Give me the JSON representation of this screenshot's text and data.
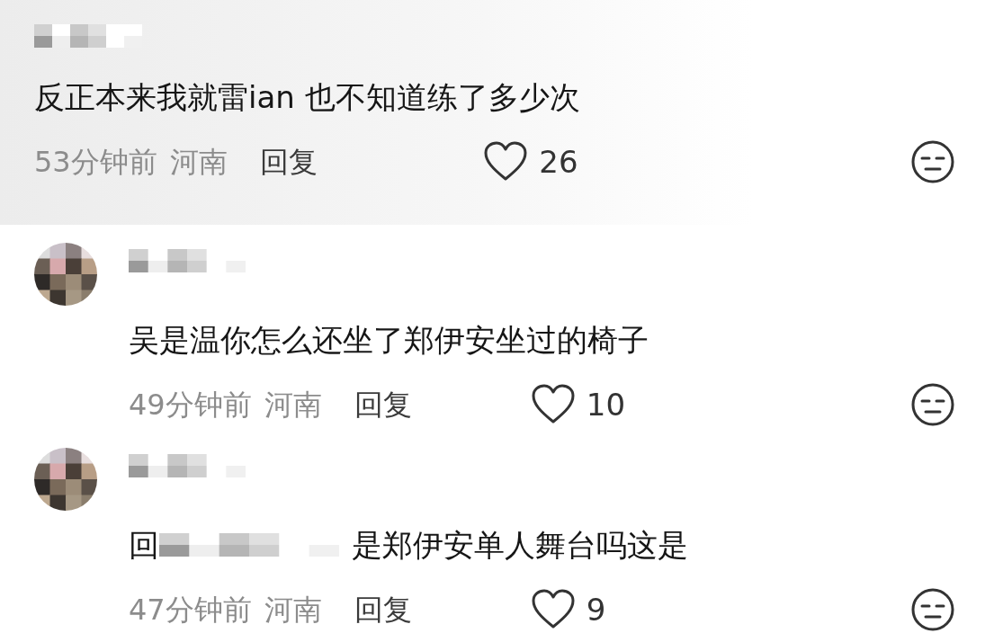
{
  "comments": [
    {
      "kind": "top",
      "text": "反正本来我就雷ian  也不知道练了多少次",
      "time": "53分钟前",
      "location": "河南",
      "reply_label": "回复",
      "likes": "26"
    },
    {
      "kind": "reply",
      "text": "吴是温你怎么还坐了郑伊安坐过的椅子",
      "time": "49分钟前",
      "location": "河南",
      "reply_label": "回复",
      "likes": "10"
    },
    {
      "kind": "reply",
      "reply_prefix": "回",
      "text": "是郑伊安单人舞台吗这是",
      "time": "47分钟前",
      "location": "河南",
      "reply_label": "回复",
      "likes": "9"
    }
  ]
}
